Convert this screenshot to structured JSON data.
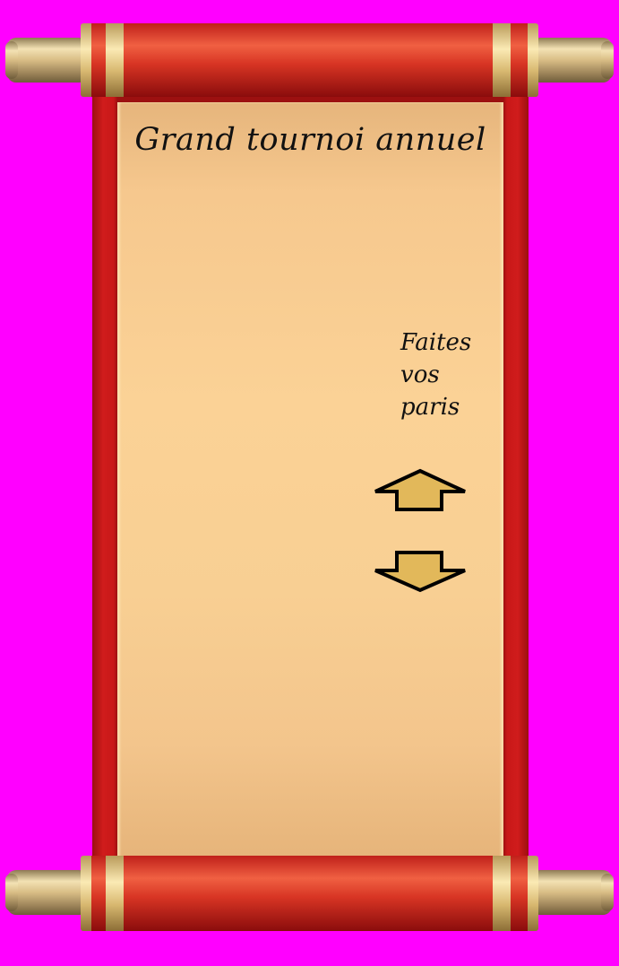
{
  "scroll": {
    "title": "Grand tournoi annuel",
    "bet_prompt_lines": [
      "Faites",
      "vos",
      "paris"
    ]
  },
  "controls": {
    "up_icon": "arrow-up-icon",
    "down_icon": "arrow-down-icon"
  },
  "colors": {
    "background": "#ff00ff",
    "scroll_red": "#c81818",
    "parchment": "#fbd296",
    "arrow_fill": "#e2b85a",
    "handle_gold": "#e8cc8a"
  }
}
